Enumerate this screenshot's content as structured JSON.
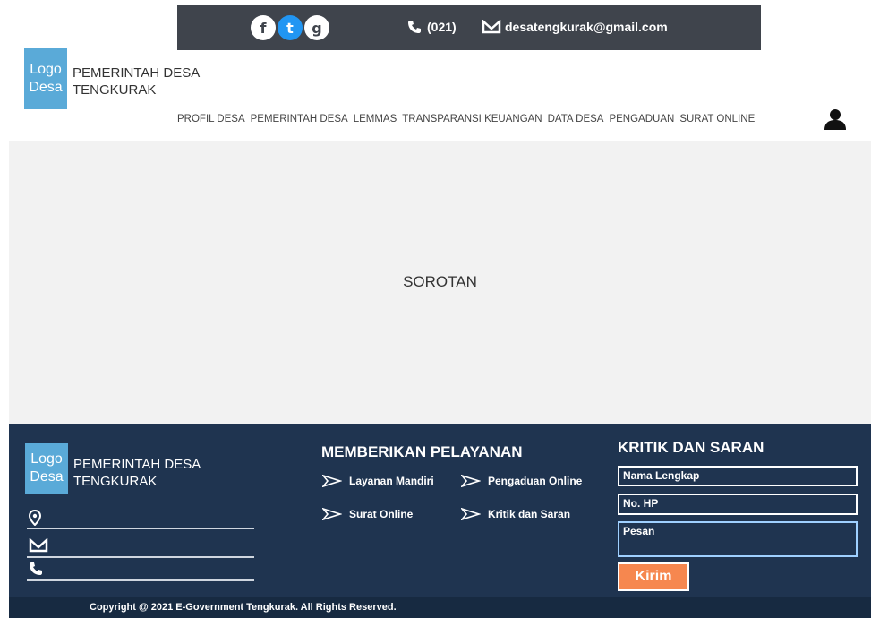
{
  "topbar": {
    "social_icons": [
      "facebook-icon",
      "twitter-icon",
      "google-plus-icon"
    ],
    "phone": "(021)",
    "email": "desatengkurak@gmail.com"
  },
  "header": {
    "logo_line1": "Logo",
    "logo_line2": "Desa",
    "title_line1": "PEMERINTAH DESA",
    "title_line2": "TENGKURAK"
  },
  "nav": {
    "items": [
      "PROFIL DESA",
      "PEMERINTAH DESA",
      "LEMMAS",
      "TRANSPARANSI KEUANGAN",
      "DATA DESA",
      "PENGADUAN",
      "SURAT ONLINE"
    ]
  },
  "hero": {
    "label": "SOROTAN"
  },
  "footer": {
    "logo_line1": "Logo",
    "logo_line2": "Desa",
    "title_line1": "PEMERINTAH DESA",
    "title_line2": "TENGKURAK",
    "services_title": "MEMBERIKAN PELAYANAN",
    "services": [
      "Layanan Mandiri",
      "Pengaduan Online",
      "Surat Online",
      "Kritik dan Saran"
    ],
    "kritik_title": "KRITIK DAN SARAN",
    "fields": [
      "Nama Lengkap",
      "No. HP",
      "Pesan"
    ],
    "submit": "Kirim",
    "copyright": "Copyright @ 2021 E-Government Tengkurak. All Rights Reserved."
  },
  "colors": {
    "topbar": "#3f444c",
    "logo": "#5aaad8",
    "footer": "#1f3450",
    "button": "#f6874f"
  }
}
